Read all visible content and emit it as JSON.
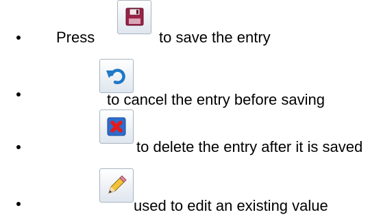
{
  "instructions": {
    "items": [
      {
        "prefix": "Press",
        "icon": "save-icon",
        "text": "to save the entry"
      },
      {
        "prefix": "",
        "icon": "undo-icon",
        "text": "to cancel the entry before saving"
      },
      {
        "prefix": "",
        "icon": "delete-icon",
        "text": "to delete the entry after it is saved"
      },
      {
        "prefix": "",
        "icon": "edit-icon",
        "text": "used to edit an existing value"
      }
    ]
  }
}
